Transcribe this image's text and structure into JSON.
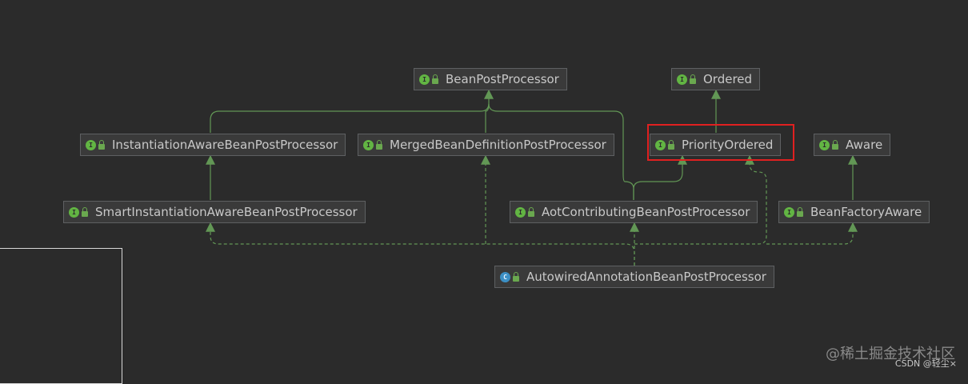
{
  "diagram": {
    "nodes": [
      {
        "id": "bpp",
        "label": "BeanPostProcessor",
        "kind": "interface",
        "icon": "interface-icon"
      },
      {
        "id": "ordered",
        "label": "Ordered",
        "kind": "interface",
        "icon": "interface-icon"
      },
      {
        "id": "iabpp",
        "label": "InstantiationAwareBeanPostProcessor",
        "kind": "interface",
        "icon": "interface-icon"
      },
      {
        "id": "mbdpp",
        "label": "MergedBeanDefinitionPostProcessor",
        "kind": "interface",
        "icon": "interface-icon"
      },
      {
        "id": "priority",
        "label": "PriorityOrdered",
        "kind": "interface",
        "icon": "interface-icon"
      },
      {
        "id": "aware",
        "label": "Aware",
        "kind": "interface",
        "icon": "interface-icon"
      },
      {
        "id": "siabpp",
        "label": "SmartInstantiationAwareBeanPostProcessor",
        "kind": "interface",
        "icon": "interface-icon"
      },
      {
        "id": "aot",
        "label": "AotContributingBeanPostProcessor",
        "kind": "interface",
        "icon": "interface-icon"
      },
      {
        "id": "bfa",
        "label": "BeanFactoryAware",
        "kind": "interface",
        "icon": "interface-icon"
      },
      {
        "id": "aabpp",
        "label": "AutowiredAnnotationBeanPostProcessor",
        "kind": "class",
        "icon": "class-icon"
      }
    ],
    "edges": [
      {
        "from": "iabpp",
        "to": "bpp",
        "type": "extends"
      },
      {
        "from": "mbdpp",
        "to": "bpp",
        "type": "extends"
      },
      {
        "from": "aot",
        "to": "bpp",
        "type": "extends"
      },
      {
        "from": "priority",
        "to": "ordered",
        "type": "extends"
      },
      {
        "from": "siabpp",
        "to": "iabpp",
        "type": "extends"
      },
      {
        "from": "aot",
        "to": "priority",
        "type": "extends"
      },
      {
        "from": "bfa",
        "to": "aware",
        "type": "extends"
      },
      {
        "from": "aabpp",
        "to": "aot",
        "type": "implements"
      },
      {
        "from": "aabpp",
        "to": "siabpp",
        "type": "implements"
      },
      {
        "from": "aabpp",
        "to": "mbdpp",
        "type": "implements"
      },
      {
        "from": "aabpp",
        "to": "priority",
        "type": "implements"
      },
      {
        "from": "aabpp",
        "to": "bfa",
        "type": "implements"
      }
    ],
    "highlighted_node": "priority"
  },
  "colors": {
    "background": "#2b2b2b",
    "edge": "#629755",
    "highlight": "#e02020",
    "interface_badge": "#62b543",
    "class_badge": "#3c8fc4"
  },
  "watermark": {
    "main": "@稀土掘金技术社区",
    "sub": "CSDN @轻尘×"
  }
}
